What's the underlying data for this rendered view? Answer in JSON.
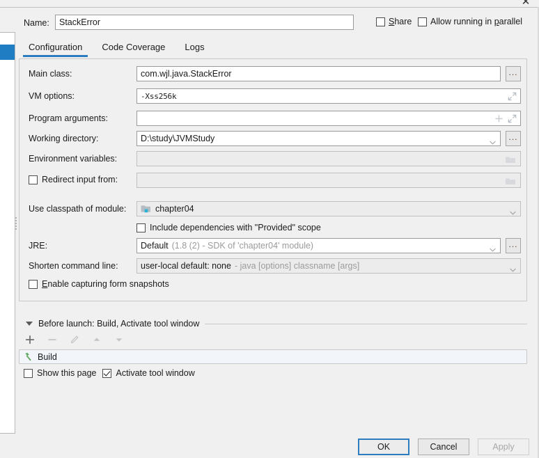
{
  "window": {
    "close_icon": "close-icon"
  },
  "name_row": {
    "label": "Name:",
    "value": "StackError",
    "placeholder": "",
    "share_label": "Share",
    "share_mnemonic": "S",
    "share_checked": false,
    "parallel_label": "Allow running in parallel",
    "parallel_mnemonic": "p",
    "parallel_checked": false
  },
  "tabs": [
    {
      "label": "Configuration",
      "active": true
    },
    {
      "label": "Code Coverage",
      "active": false
    },
    {
      "label": "Logs",
      "active": false
    }
  ],
  "config": {
    "main_class": {
      "label": "Main class:",
      "value": "com.wjl.java.StackError",
      "browse_label": "..."
    },
    "vm_options": {
      "label": "VM options:",
      "value": "-Xss256k",
      "expand_icon": "expand-icon"
    },
    "program_arguments": {
      "label": "Program arguments:",
      "value": "",
      "add_icon": "plus-icon",
      "expand_icon": "expand-icon"
    },
    "working_directory": {
      "label": "Working directory:",
      "value": "D:\\study\\JVMStudy",
      "dropdown_icon": "chevron-down-icon",
      "browse_label": "..."
    },
    "environment_variables": {
      "label": "Environment variables:",
      "value": "",
      "folder_icon": "folder-icon"
    },
    "redirect_input": {
      "label": "Redirect input from:",
      "checked": false,
      "value": "",
      "folder_icon": "folder-icon"
    },
    "classpath_module": {
      "label": "Use classpath of module:",
      "value": "chapter04",
      "module_icon": "module-icon",
      "dropdown_icon": "chevron-down-icon"
    },
    "include_provided": {
      "label": "Include dependencies with \"Provided\" scope",
      "checked": false
    },
    "jre": {
      "label": "JRE:",
      "value": "Default",
      "hint": "(1.8 (2) - SDK of 'chapter04' module)",
      "dropdown_icon": "chevron-down-icon",
      "browse_label": "..."
    },
    "shorten_command_line": {
      "label": "Shorten command line:",
      "value": "user-local default: none",
      "hint": "- java [options] classname [args]",
      "dropdown_icon": "chevron-down-icon"
    },
    "enable_snapshots": {
      "label": "Enable capturing form snapshots",
      "mnemonic": "E",
      "checked": false
    }
  },
  "before_launch": {
    "header": "Before launch: Build, Activate tool window",
    "collapse_icon": "triangle-down-icon",
    "toolbar": [
      {
        "name": "add-button",
        "glyph": "+",
        "enabled": true
      },
      {
        "name": "remove-button",
        "glyph": "−",
        "enabled": false
      },
      {
        "name": "edit-button",
        "glyph": "pencil-icon",
        "enabled": false
      },
      {
        "name": "move-up-button",
        "glyph": "triangle-up-icon",
        "enabled": false
      },
      {
        "name": "move-down-button",
        "glyph": "triangle-down-icon",
        "enabled": false
      }
    ],
    "items": [
      {
        "label": "Build",
        "icon": "hammer-icon"
      }
    ],
    "show_this_page": {
      "label": "Show this page",
      "checked": false
    },
    "activate_tool_window": {
      "label": "Activate tool window",
      "checked": true
    }
  },
  "buttons": {
    "ok": "OK",
    "cancel": "Cancel",
    "apply": "Apply"
  },
  "colors": {
    "accent": "#2d7cc0",
    "selection": "#1f7dc4",
    "panel_bg": "#f0f0f0",
    "field_bg": "#ffffff",
    "disabled_text": "#9b9b9b",
    "list_row_bg": "#f2f6fb",
    "hammer_green": "#5a9e5a"
  }
}
